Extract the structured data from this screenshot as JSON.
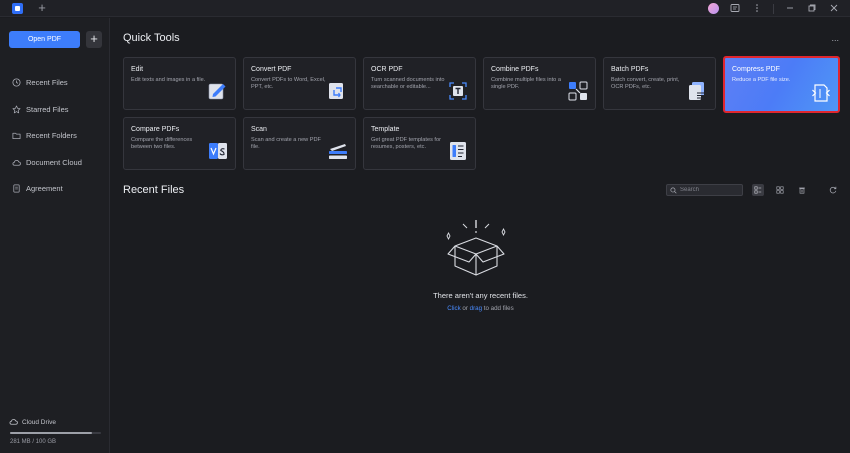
{
  "titlebar": {
    "new_tab": "+",
    "icons": [
      "app-logo",
      "avatar",
      "panel-icon",
      "more-vert-icon",
      "minimize-icon",
      "restore-icon",
      "close-icon"
    ]
  },
  "sidebar": {
    "open_pdf": "Open PDF",
    "add": "+",
    "items": [
      {
        "label": "Recent Files",
        "icon": "clock-icon"
      },
      {
        "label": "Starred Files",
        "icon": "star-icon"
      },
      {
        "label": "Recent Folders",
        "icon": "folder-icon"
      },
      {
        "label": "Document Cloud",
        "icon": "cloud-icon"
      },
      {
        "label": "Agreement",
        "icon": "agreement-icon"
      }
    ],
    "cloud_drive": "Cloud Drive",
    "storage_text": "281 MB / 100 GB",
    "storage_used_fraction": 0.9
  },
  "quick_tools": {
    "heading": "Quick Tools",
    "more": "...",
    "tools": [
      {
        "title": "Edit",
        "desc": "Edit texts and images in a file.",
        "icon": "edit-icon"
      },
      {
        "title": "Convert PDF",
        "desc": "Convert PDFs to Word, Excel, PPT, etc.",
        "icon": "convert-icon"
      },
      {
        "title": "OCR PDF",
        "desc": "Turn scanned documents into searchable or editable...",
        "icon": "ocr-icon"
      },
      {
        "title": "Combine PDFs",
        "desc": "Combine multiple files into a single PDF.",
        "icon": "combine-icon"
      },
      {
        "title": "Batch PDFs",
        "desc": "Batch convert, create, print, OCR PDFs, etc.",
        "icon": "batch-icon"
      },
      {
        "title": "Compress PDF",
        "desc": "Reduce a PDF file size.",
        "icon": "compress-icon"
      },
      {
        "title": "Compare PDFs",
        "desc": "Compare the differences between two files.",
        "icon": "compare-icon"
      },
      {
        "title": "Scan",
        "desc": "Scan and create a new PDF file.",
        "icon": "scan-icon"
      },
      {
        "title": "Template",
        "desc": "Get great PDF templates for resumes, posters, etc.",
        "icon": "template-icon"
      }
    ]
  },
  "recent": {
    "heading": "Recent Files",
    "search_placeholder": "Search",
    "empty_title": "There aren't any recent files.",
    "empty_click": "Click",
    "empty_or": " or ",
    "empty_drag": "drag",
    "empty_rest": " to add files"
  },
  "colors": {
    "accent": "#3d7dfb",
    "highlight_border": "#e0262f",
    "background": "#1b1c20"
  }
}
